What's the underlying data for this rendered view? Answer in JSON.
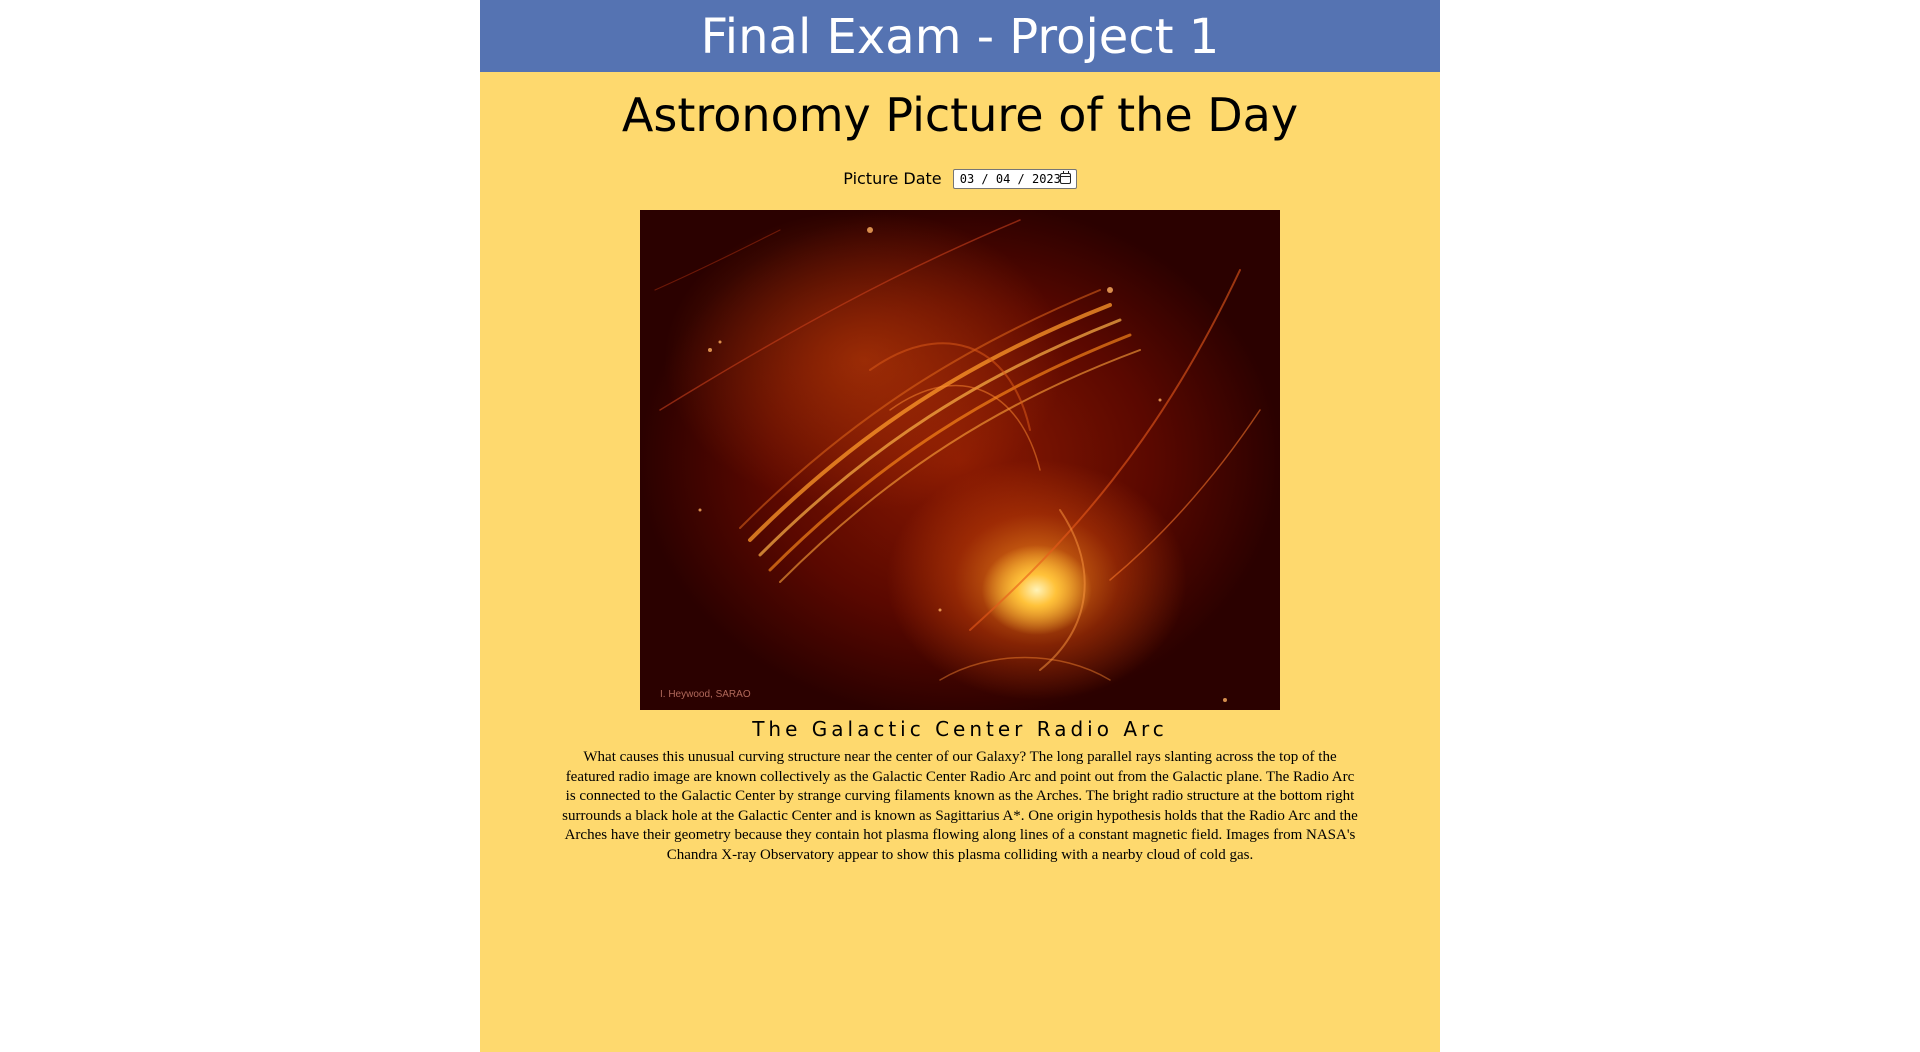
{
  "banner": {
    "title": "Final Exam - Project 1"
  },
  "heading": {
    "text": "Astronomy Picture of the Day"
  },
  "date_picker": {
    "label": "Picture Date",
    "value": "03 / 04 / 2023",
    "icon": "calendar-icon"
  },
  "apod": {
    "image_credit": "I. Heywood, SARAO",
    "title": "The Galactic Center Radio Arc",
    "explanation": "What causes this unusual curving structure near the center of our Galaxy? The long parallel rays slanting across the top of the featured radio image are known collectively as the Galactic Center Radio Arc and point out from the Galactic plane. The Radio Arc is connected to the Galactic Center by strange curving filaments known as the Arches. The bright radio structure at the bottom right surrounds a black hole at the Galactic Center and is known as Sagittarius A*. One origin hypothesis holds that the Radio Arc and the Arches have their geometry because they contain hot plasma flowing along lines of a constant magnetic field. Images from NASA's Chandra X-ray Observatory appear to show this plasma colliding with a nearby cloud of cold gas."
  },
  "colors": {
    "banner_bg": "#5573b2",
    "page_bg": "#fed96e"
  }
}
